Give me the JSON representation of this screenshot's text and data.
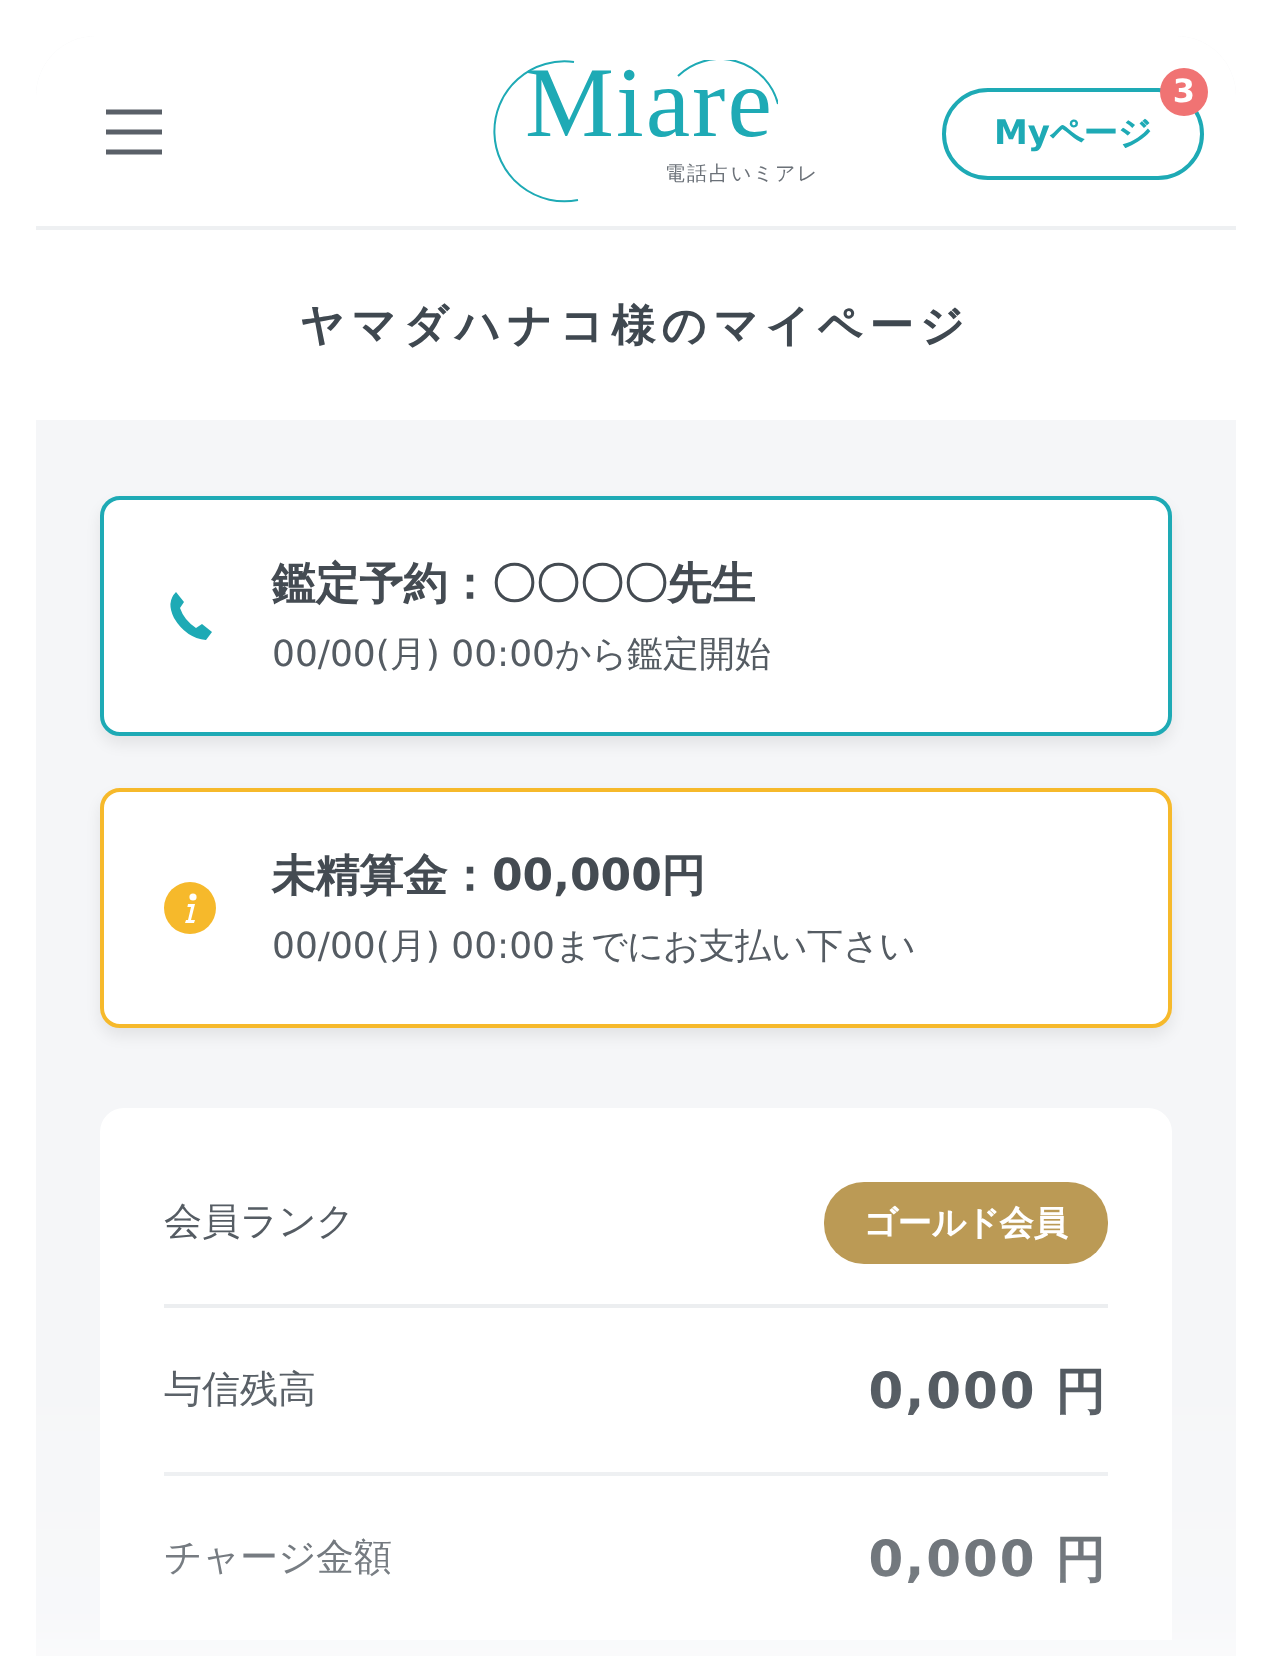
{
  "header": {
    "logo": {
      "name": "Miare",
      "tagline": "電話占いミアレ"
    },
    "mypage_button": {
      "label": "Myページ",
      "badge": "3"
    }
  },
  "page_title": "ヤマダハナコ様のマイページ",
  "notices": [
    {
      "kind": "call",
      "title": "鑑定予約：〇〇〇〇先生",
      "detail": "00/00(月) 00:00から鑑定開始"
    },
    {
      "kind": "payment",
      "title": "未精算金：00,000円",
      "detail": "00/00(月) 00:00までにお支払い下さい"
    }
  ],
  "account": [
    {
      "kind": "badge",
      "label": "会員ランク",
      "value": "ゴールド会員"
    },
    {
      "kind": "amount",
      "label": "与信残高",
      "value": "0,000 円"
    },
    {
      "kind": "amount",
      "label": "チャージ金額",
      "value": "0,000 円"
    }
  ]
}
